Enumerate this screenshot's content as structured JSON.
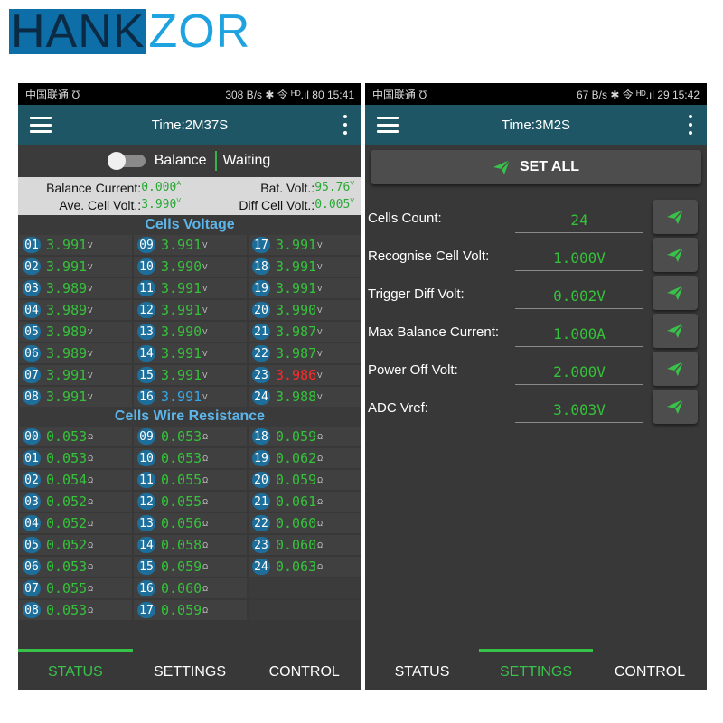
{
  "brand": {
    "part1": "HANK",
    "part2": "ZOR"
  },
  "left_phone": {
    "status_bar": {
      "carrier": "中国联通 Ʊ",
      "right": "308 B/s ✱ 令 ᴴᴰ.ıl 80 15:41"
    },
    "title": "Time:2M37S",
    "balance_label": "Balance",
    "balance_state": "Waiting",
    "balance_current_label": "Balance Current:",
    "balance_current_value": "0.000",
    "balance_current_unit": "A",
    "bat_volt_label": "Bat. Volt.:",
    "bat_volt_value": "95.76",
    "bat_volt_unit": "V",
    "ave_cell_label": "Ave. Cell Volt.:",
    "ave_cell_value": "3.990",
    "ave_cell_unit": "V",
    "diff_cell_label": "Diff Cell Volt.:",
    "diff_cell_value": "0.005",
    "diff_cell_unit": "V",
    "cells_voltage_title": "Cells Voltage",
    "cells_voltage_unit": "V",
    "cells_voltage": [
      {
        "n": "01",
        "v": "3.991",
        "c": ""
      },
      {
        "n": "09",
        "v": "3.991",
        "c": ""
      },
      {
        "n": "17",
        "v": "3.991",
        "c": ""
      },
      {
        "n": "02",
        "v": "3.991",
        "c": ""
      },
      {
        "n": "10",
        "v": "3.990",
        "c": ""
      },
      {
        "n": "18",
        "v": "3.991",
        "c": ""
      },
      {
        "n": "03",
        "v": "3.989",
        "c": ""
      },
      {
        "n": "11",
        "v": "3.991",
        "c": ""
      },
      {
        "n": "19",
        "v": "3.991",
        "c": ""
      },
      {
        "n": "04",
        "v": "3.989",
        "c": ""
      },
      {
        "n": "12",
        "v": "3.991",
        "c": ""
      },
      {
        "n": "20",
        "v": "3.990",
        "c": ""
      },
      {
        "n": "05",
        "v": "3.989",
        "c": ""
      },
      {
        "n": "13",
        "v": "3.990",
        "c": ""
      },
      {
        "n": "21",
        "v": "3.987",
        "c": ""
      },
      {
        "n": "06",
        "v": "3.989",
        "c": ""
      },
      {
        "n": "14",
        "v": "3.991",
        "c": ""
      },
      {
        "n": "22",
        "v": "3.987",
        "c": ""
      },
      {
        "n": "07",
        "v": "3.991",
        "c": ""
      },
      {
        "n": "15",
        "v": "3.991",
        "c": ""
      },
      {
        "n": "23",
        "v": "3.986",
        "c": "red"
      },
      {
        "n": "08",
        "v": "3.991",
        "c": ""
      },
      {
        "n": "16",
        "v": "3.991",
        "c": "blue"
      },
      {
        "n": "24",
        "v": "3.988",
        "c": ""
      }
    ],
    "wire_resistance_title": "Cells Wire Resistance",
    "wire_resistance_unit": "Ω",
    "wire_resistance": [
      {
        "n": "00",
        "v": "0.053"
      },
      {
        "n": "09",
        "v": "0.053"
      },
      {
        "n": "18",
        "v": "0.059"
      },
      {
        "n": "01",
        "v": "0.053"
      },
      {
        "n": "10",
        "v": "0.053"
      },
      {
        "n": "19",
        "v": "0.062"
      },
      {
        "n": "02",
        "v": "0.054"
      },
      {
        "n": "11",
        "v": "0.055"
      },
      {
        "n": "20",
        "v": "0.059"
      },
      {
        "n": "03",
        "v": "0.052"
      },
      {
        "n": "12",
        "v": "0.055"
      },
      {
        "n": "21",
        "v": "0.061"
      },
      {
        "n": "04",
        "v": "0.052"
      },
      {
        "n": "13",
        "v": "0.056"
      },
      {
        "n": "22",
        "v": "0.060"
      },
      {
        "n": "05",
        "v": "0.052"
      },
      {
        "n": "14",
        "v": "0.058"
      },
      {
        "n": "23",
        "v": "0.060"
      },
      {
        "n": "06",
        "v": "0.053"
      },
      {
        "n": "15",
        "v": "0.059"
      },
      {
        "n": "24",
        "v": "0.063"
      },
      {
        "n": "07",
        "v": "0.055"
      },
      {
        "n": "16",
        "v": "0.060"
      },
      null,
      {
        "n": "08",
        "v": "0.053"
      },
      {
        "n": "17",
        "v": "0.059"
      },
      null
    ],
    "nav": {
      "status": "STATUS",
      "settings": "SETTINGS",
      "control": "CONTROL",
      "active": "status"
    }
  },
  "right_phone": {
    "status_bar": {
      "carrier": "中国联通 Ʊ",
      "right": "67 B/s ✱ 令 ᴴᴰ.ıl 29 15:42"
    },
    "title": "Time:3M2S",
    "set_all": "SET ALL",
    "settings": [
      {
        "label": "Cells Count:",
        "value": "24"
      },
      {
        "label": "Recognise Cell Volt:",
        "value": "1.000V"
      },
      {
        "label": "Trigger Diff Volt:",
        "value": "0.002V"
      },
      {
        "label": "Max Balance Current:",
        "value": "1.000A"
      },
      {
        "label": "Power Off Volt:",
        "value": "2.000V"
      },
      {
        "label": "ADC Vref:",
        "value": "3.003V"
      }
    ],
    "nav": {
      "status": "STATUS",
      "settings": "SETTINGS",
      "control": "CONTROL",
      "active": "settings"
    }
  },
  "colors": {
    "accent_green": "#39c24a",
    "value_green": "#35c23a",
    "header_teal": "#1e5666",
    "brand_blue": "#1ea3e0",
    "alert_red": "#ff2a2a"
  },
  "icons": {
    "menu": "hamburger-menu-icon",
    "more": "more-vert-icon",
    "send": "send-plane-icon"
  }
}
